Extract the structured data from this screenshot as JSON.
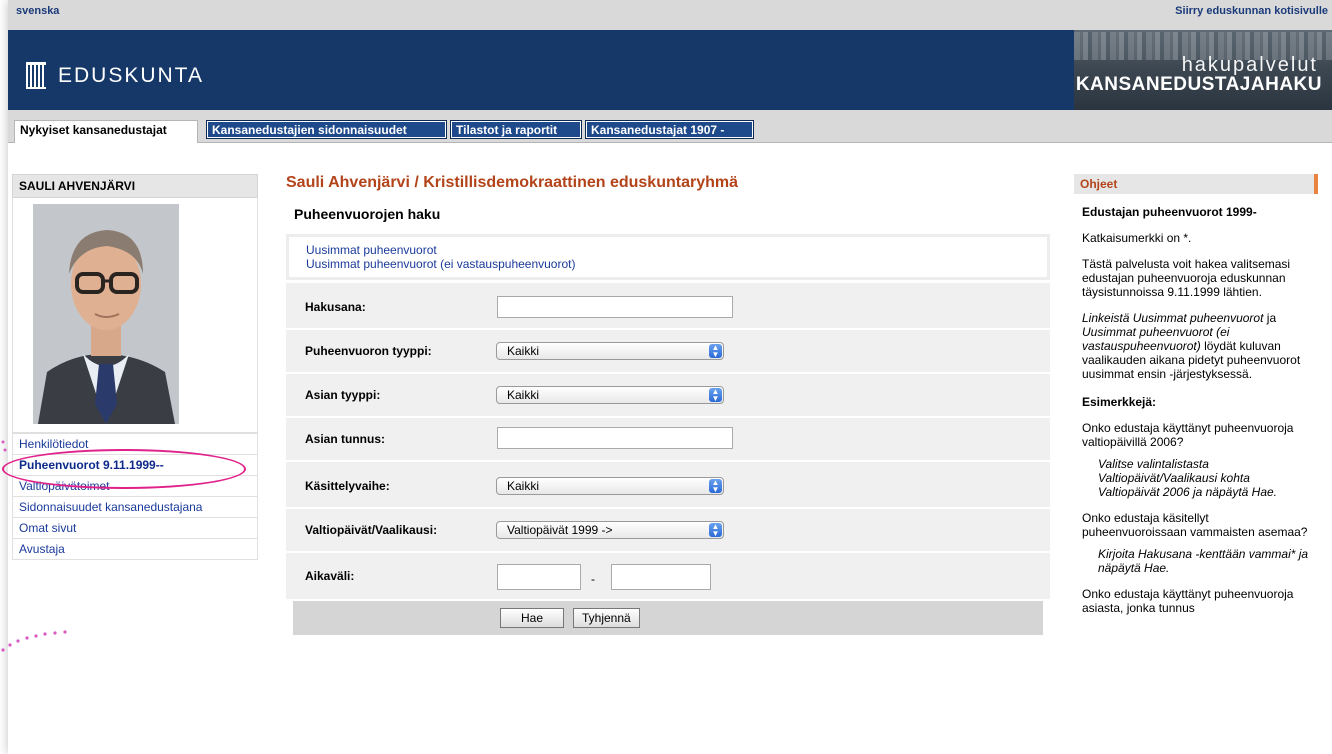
{
  "topbar": {
    "language_link": "svenska",
    "home_link": "Siirry eduskunnan kotisivulle"
  },
  "header": {
    "logo_text": "EDUSKUNTA",
    "banner_line1": "hakupalvelut",
    "banner_line2": "KANSANEDUSTAJAHAKU"
  },
  "tabs": [
    {
      "label": "Nykyiset kansanedustajat"
    },
    {
      "label": "Kansanedustajien sidonnaisuudet"
    },
    {
      "label": "Tilastot ja raportit"
    },
    {
      "label": "Kansanedustajat 1907 -"
    }
  ],
  "sidebar": {
    "name": "SAULI AHVENJÄRVI",
    "items": [
      {
        "label": "Henkilötiedot"
      },
      {
        "label": "Puheenvuorot 9.11.1999--"
      },
      {
        "label": "Valtiopäivätoimet"
      },
      {
        "label": "Sidonnaisuudet kansanedustajana"
      },
      {
        "label": "Omat sivut"
      },
      {
        "label": "Avustaja"
      }
    ]
  },
  "main": {
    "title": "Sauli Ahvenjärvi / Kristillisdemokraattinen eduskuntaryhmä",
    "subtitle": "Puheenvuorojen haku",
    "links": [
      "Uusimmat puheenvuorot",
      "Uusimmat puheenvuorot (ei vastauspuheenvuorot)"
    ],
    "form": {
      "hakusana_label": "Hakusana:",
      "tyyppi_label": "Puheenvuoron tyyppi:",
      "tyyppi_value": "Kaikki",
      "asian_tyyppi_label": "Asian tyyppi:",
      "asian_tyyppi_value": "Kaikki",
      "asian_tunnus_label": "Asian tunnus:",
      "vaihe_label": "Käsittelyvaihe:",
      "vaihe_value": "Kaikki",
      "valtiopaivat_label": "Valtiopäivät/Vaalikausi:",
      "valtiopaivat_value": "Valtiopäivät 1999 ->",
      "aikavali_label": "Aikaväli:",
      "aikavali_sep": "-"
    },
    "buttons": {
      "search": "Hae",
      "clear": "Tyhjennä"
    }
  },
  "help": {
    "header": "Ohjeet",
    "heading": "Edustajan puheenvuorot 1999-",
    "p1": "Katkaisumerkki on *.",
    "p2": "Tästä palvelusta voit hakea valitsemasi edustajan puheenvuoroja eduskunnan täysistunnoissa 9.11.1999 lähtien.",
    "p3_em1": "Linkeistä Uusimmat puheenvuorot",
    "p3_mid": " ja ",
    "p3_em2": "Uusimmat puheenvuorot (ei vastauspuheenvuorot)",
    "p3_rest": " löydät kuluvan vaalikauden aikana pidetyt puheenvuorot uusimmat ensin -järjestyksessä.",
    "examples_heading": "Esimerkkejä:",
    "q1": "Onko edustaja käyttänyt puheenvuoroja valtiopäivillä 2006?",
    "a1": "Valitse valintalistasta Valtiopäivät/Vaalikausi kohta Valtiopäivät 2006 ja näpäytä Hae.",
    "q2": "Onko edustaja käsitellyt puheenvuoroissaan vammaisten asemaa?",
    "a2": "Kirjoita Hakusana -kenttään vammai* ja näpäytä Hae.",
    "q3": "Onko edustaja käyttänyt puheenvuoroja asiasta, jonka tunnus"
  },
  "colors": {
    "header_bg": "#163868",
    "tab_bg": "#1e4a8c",
    "title": "#b3441a",
    "link": "#1a3a9a",
    "highlight": "#e0218a"
  }
}
